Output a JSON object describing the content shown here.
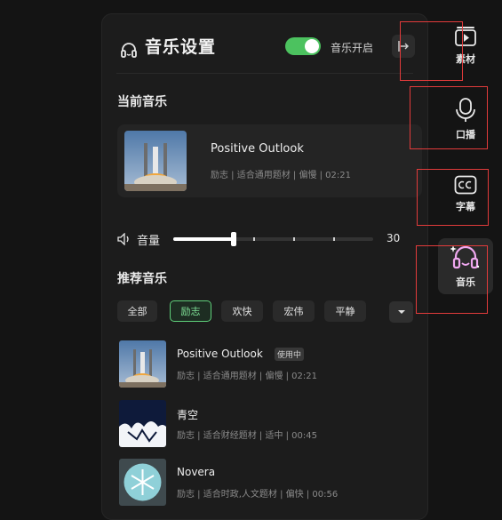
{
  "panel": {
    "title": "音乐设置",
    "toggle_label": "音乐开启",
    "toggle_on": true,
    "accent_color": "#4cc25f"
  },
  "current": {
    "section_title": "当前音乐",
    "name": "Positive Outlook",
    "meta": "励志 | 适合通用题材 | 偏慢 | 02:21"
  },
  "volume": {
    "label": "音量",
    "value": "30",
    "level": 0.3
  },
  "recommended": {
    "section_title": "推荐音乐",
    "chips": [
      "全部",
      "励志",
      "欢快",
      "宏伟",
      "平静"
    ],
    "active_chip": "励志",
    "tracks": [
      {
        "name": "Positive Outlook",
        "badge": "使用中",
        "meta": "励志 | 适合通用题材 | 偏慢 | 02:21",
        "icon": "rocket-launch-thumb"
      },
      {
        "name": "青空",
        "badge": "",
        "meta": "励志 | 适合财经题材 | 适中 | 00:45",
        "icon": "sky-silhouette-thumb"
      },
      {
        "name": "Novera",
        "badge": "",
        "meta": "励志 | 适合时政,人文题材 | 偏快 | 00:56",
        "icon": "snowflake-thumb"
      }
    ]
  },
  "sidebar": {
    "items": [
      {
        "label": "素材",
        "icon": "media-play-icon"
      },
      {
        "label": "口播",
        "icon": "microphone-icon"
      },
      {
        "label": "字幕",
        "icon": "cc-icon"
      },
      {
        "label": "音乐",
        "icon": "headphones-icon"
      }
    ],
    "active": "音乐"
  }
}
